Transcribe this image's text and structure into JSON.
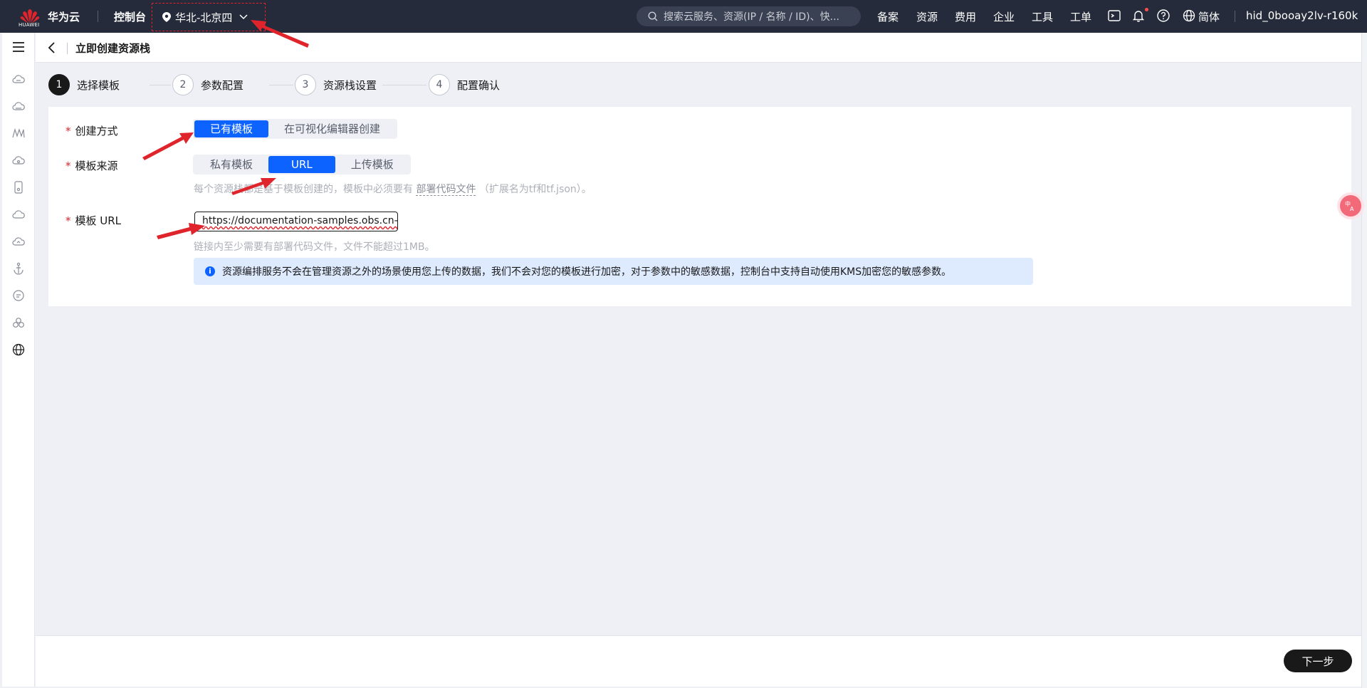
{
  "topbar": {
    "logo_text": "HUAWEI",
    "brand": "华为云",
    "console": "控制台",
    "region": "华北-北京四",
    "search_placeholder": "搜索云服务、资源(IP / 名称 / ID)、快...",
    "nav": [
      "备案",
      "资源",
      "费用",
      "企业",
      "工具",
      "工单"
    ],
    "language": "简体",
    "user": "hid_0booay2lv-r160k"
  },
  "header": {
    "title": "立即创建资源栈"
  },
  "steps": [
    {
      "num": "1",
      "label": "选择模板"
    },
    {
      "num": "2",
      "label": "参数配置"
    },
    {
      "num": "3",
      "label": "资源栈设置"
    },
    {
      "num": "4",
      "label": "配置确认"
    }
  ],
  "form": {
    "create_method": {
      "label": "创建方式",
      "options": [
        "已有模板",
        "在可视化编辑器创建"
      ],
      "selected": "已有模板"
    },
    "template_source": {
      "label": "模板来源",
      "options": [
        "私有模板",
        "URL",
        "上传模板"
      ],
      "selected": "URL",
      "hint_before": "每个资源栈都是基于模板创建的，模板中必须要有",
      "hint_link": "部署代码文件",
      "hint_after": "（扩展名为tf和tf.json）。"
    },
    "template_url": {
      "label": "模板 URL",
      "value": "https://documentation-samples.obs.cn-",
      "hint": "链接内至少需要有部署代码文件，文件不能超过1MB。"
    },
    "notice": "资源编排服务不会在管理资源之外的场景使用您上传的数据，我们不会对您的模板进行加密，对于参数中的敏感数据，控制台中支持自动使用KMS加密您的敏感参数。"
  },
  "footer": {
    "next_label": "下一步"
  },
  "colors": {
    "primary": "#0d63ff",
    "topbar": "#252b3a",
    "required": "#e0242c",
    "annotation": "#e0242c"
  }
}
